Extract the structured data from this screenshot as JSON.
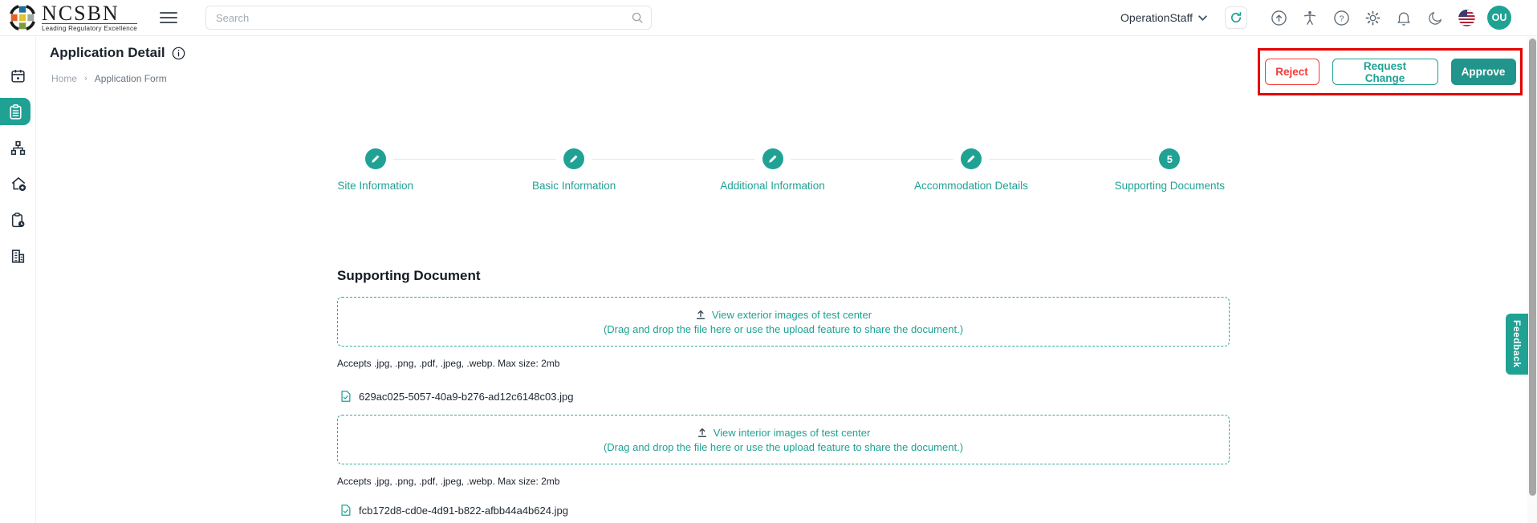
{
  "colors": {
    "accent": "#1fa294",
    "accent_dark": "#21958b",
    "danger": "#f23b3b",
    "annotation_red": "#e60000"
  },
  "header": {
    "brand": "NCSBN",
    "tagline": "Leading Regulatory Excellence",
    "search_placeholder": "Search",
    "user_role": "OperationStaff",
    "avatar_initials": "OU"
  },
  "sidebar": {
    "items": [
      {
        "name": "calendar",
        "active": false
      },
      {
        "name": "applications",
        "active": true
      },
      {
        "name": "org-chart",
        "active": false
      },
      {
        "name": "site-add",
        "active": false
      },
      {
        "name": "pending-tasks",
        "active": false
      },
      {
        "name": "organizations",
        "active": false
      }
    ]
  },
  "page": {
    "title": "Application Detail",
    "breadcrumb": {
      "home": "Home",
      "separator": "›",
      "current": "Application Form"
    },
    "actions": {
      "reject": "Reject",
      "request_change": "Request Change",
      "approve": "Approve"
    }
  },
  "stepper": {
    "steps": [
      {
        "label": "Site Information",
        "state": "completed"
      },
      {
        "label": "Basic Information",
        "state": "completed"
      },
      {
        "label": "Additional Information",
        "state": "completed"
      },
      {
        "label": "Accommodation Details",
        "state": "completed"
      },
      {
        "label": "Supporting Documents",
        "state": "current",
        "number": "5"
      }
    ]
  },
  "content": {
    "section_title": "Supporting Document",
    "uploads": [
      {
        "title": "View exterior images of test center",
        "hint": "(Drag and drop the file here or use the upload feature to share the document.)",
        "accepts": "Accepts .jpg, .png, .pdf, .jpeg, .webp. Max size: 2mb",
        "file": "629ac025-5057-40a9-b276-ad12c6148c03.jpg"
      },
      {
        "title": "View interior images of test center",
        "hint": "(Drag and drop the file here or use the upload feature to share the document.)",
        "accepts": "Accepts .jpg, .png, .pdf, .jpeg, .webp. Max size: 2mb",
        "file": "fcb172d8-cd0e-4d91-b822-afbb44a4b624.jpg"
      }
    ]
  },
  "feedback_tab": "Feedback"
}
